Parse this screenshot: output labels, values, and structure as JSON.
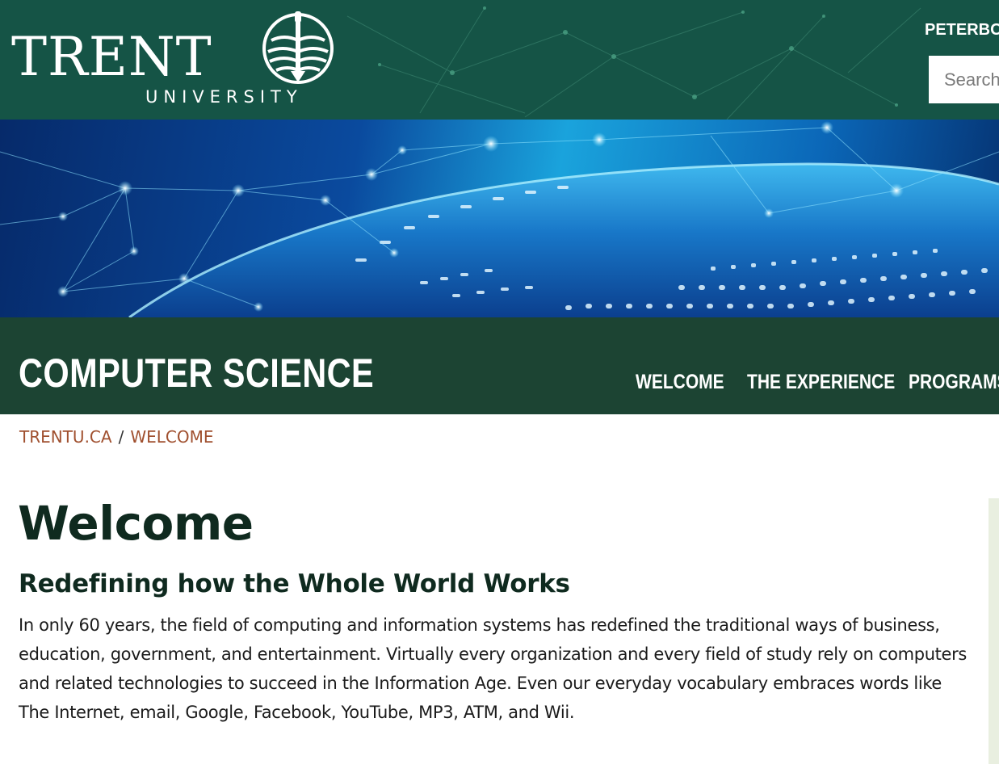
{
  "header": {
    "logo": {
      "wordmark": "TRENT",
      "subline": "UNIVERSITY"
    },
    "campus_link": "PETERBO",
    "search": {
      "placeholder": "Search",
      "value": ""
    }
  },
  "department": {
    "title": "COMPUTER SCIENCE",
    "nav": [
      {
        "label": "WELCOME"
      },
      {
        "label": "THE EXPERIENCE"
      },
      {
        "label": "PROGRAMS"
      }
    ]
  },
  "breadcrumb": [
    {
      "label": "TRENTU.CA"
    },
    {
      "label": "WELCOME"
    }
  ],
  "content": {
    "title": "Welcome",
    "subtitle": "Redefining how the Whole World Works",
    "intro": "In only 60 years, the field of computing and information systems has redefined the traditional ways of business, education, government, and entertainment.  Virtually every organization and every field of study rely on computers and related technologies to succeed in the Information Age.  Even our everyday vocabulary embraces words like The Internet, email, Google, Facebook, YouTube, MP3, ATM, and Wii."
  },
  "colors": {
    "header_green": "#155446",
    "dept_green": "#1c4433",
    "breadcrumb_link": "#a0502f",
    "heading_text": "#0f2a1f"
  }
}
